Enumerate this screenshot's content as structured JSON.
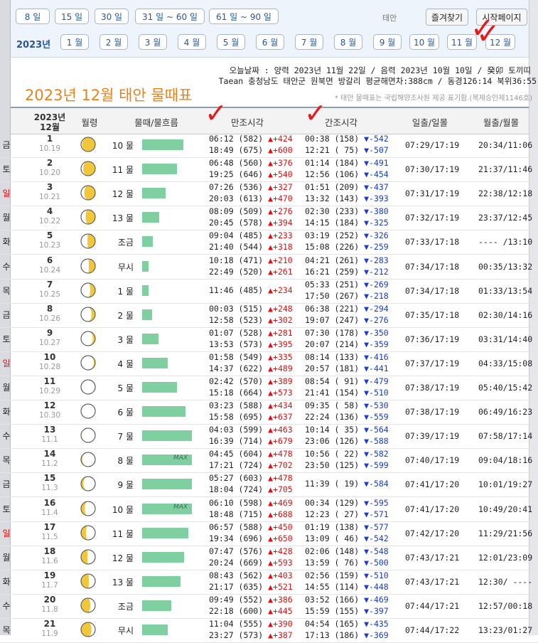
{
  "range_buttons": [
    "8 일",
    "15 일",
    "30 일",
    "31 일 ~ 60 일",
    "61 일 ~ 90 일"
  ],
  "taean_label": "태안",
  "favorites_label": "즐겨찾기",
  "homepage_label": "시작페이지",
  "year_label": "2023년",
  "months": [
    "1 월",
    "2 월",
    "3 월",
    "4 월",
    "5 월",
    "6 월",
    "7 월",
    "8 월",
    "9 월",
    "10 월",
    "11 월",
    "12 월"
  ],
  "info_line1": "오늘날짜 : 양력 2023년 11월 22일 / 음력 2023년 10월 10일 / 癸卯 토끼띠",
  "info_line2": "Taean 충청남도 태안군 원북면 방갈리 평균해면차:388cm / 동경126:14 북위36:55",
  "page_title": "2023년 12월 태안 물때표",
  "notice": "* 태안 물때표는 국립해양조사원 제공 표기함.(복제승인제1146호)",
  "header": {
    "date_top": "2023년",
    "date_bottom": "12월",
    "moon": "월령",
    "tide": "물때/물흐름",
    "high": "만조시각",
    "low": "간조시각",
    "sunrise": "일출/일몰",
    "moonrise": "월출/월몰"
  },
  "colors": {
    "bar": "#7fcfa0",
    "up": "#e01010",
    "down": "#1a3bd0",
    "title": "#e8821e",
    "check": "#e21b1b"
  },
  "rows": [
    {
      "dow": "금",
      "day": "1",
      "lunar": "10.19",
      "moon": 0.92,
      "tide": "10 물",
      "flow": 0.45,
      "max": "",
      "h1": "06:12 (582)",
      "h1d": "▲+424",
      "h2": "18:49 (675)",
      "h2d": "▲+600",
      "l1": "00:38 (158)",
      "l1d": "▼-542",
      "l2": "12:21 ( 75)",
      "l2d": "▼-507",
      "sun": "07:29/17:19",
      "moonrise": "20:34/11:06"
    },
    {
      "dow": "토",
      "day": "2",
      "lunar": "10.20",
      "moon": 0.85,
      "tide": "11 물",
      "flow": 0.38,
      "max": "",
      "h1": "06:48 (560)",
      "h1d": "▲+376",
      "h2": "19:25 (646)",
      "h2d": "▲+540",
      "l1": "01:14 (184)",
      "l1d": "▼-491",
      "l2": "12:56 (106)",
      "l2d": "▼-454",
      "sun": "07:30/17:19",
      "moonrise": "21:37/11:46"
    },
    {
      "dow": "일",
      "day": "3",
      "lunar": "10.21",
      "moon": 0.77,
      "tide": "12 물",
      "flow": 0.26,
      "max": "",
      "h1": "07:26 (536)",
      "h1d": "▲+327",
      "h2": "20:03 (613)",
      "h2d": "▲+470",
      "l1": "01:51 (209)",
      "l1d": "▼-437",
      "l2": "13:32 (143)",
      "l2d": "▼-393",
      "sun": "07:31/17:19",
      "moonrise": "22:38/12:18"
    },
    {
      "dow": "월",
      "day": "4",
      "lunar": "10.22",
      "moon": 0.68,
      "tide": "13 물",
      "flow": 0.19,
      "max": "",
      "h1": "08:09 (509)",
      "h1d": "▲+276",
      "h2": "20:45 (578)",
      "h2d": "▲+394",
      "l1": "02:30 (233)",
      "l1d": "▼-380",
      "l2": "14:15 (184)",
      "l2d": "▼-325",
      "sun": "07:32/17:19",
      "moonrise": "23:37/12:45"
    },
    {
      "dow": "화",
      "day": "5",
      "lunar": "10.23",
      "moon": 0.55,
      "tide": "조금",
      "flow": 0.12,
      "max": "",
      "h1": "09:04 (485)",
      "h1d": "▲+233",
      "h2": "21:40 (544)",
      "h2d": "▲+318",
      "l1": "03:19 (252)",
      "l1d": "▼-326",
      "l2": "15:08 (226)",
      "l2d": "▼-259",
      "sun": "07:33/17:18",
      "moonrise": "---- /13:10"
    },
    {
      "dow": "수",
      "day": "6",
      "lunar": "10.24",
      "moon": 0.45,
      "tide": "무시",
      "flow": 0.07,
      "max": "",
      "h1": "10:18 (471)",
      "h1d": "▲+210",
      "h2": "22:49 (520)",
      "h2d": "▲+261",
      "l1": "04:21 (261)",
      "l1d": "▼-283",
      "l2": "16:21 (259)",
      "l2d": "▼-212",
      "sun": "07:34/17:18",
      "moonrise": "00:35/13:32"
    },
    {
      "dow": "목",
      "day": "7",
      "lunar": "10.25",
      "moon": 0.35,
      "tide": "1 물",
      "flow": 0.07,
      "max": "",
      "h1": "11:46 (485)",
      "h1d": "▲+234",
      "h2": "",
      "h2d": "",
      "l1": "05:33 (251)",
      "l1d": "▼-269",
      "l2": "17:50 (267)",
      "l2d": "▼-218",
      "sun": "07:34/17:18",
      "moonrise": "01:33/13:54"
    },
    {
      "dow": "금",
      "day": "8",
      "lunar": "10.26",
      "moon": 0.26,
      "tide": "2 물",
      "flow": 0.11,
      "max": "",
      "h1": "00:03 (515)",
      "h1d": "▲+248",
      "h2": "12:58 (523)",
      "h2d": "▲+302",
      "l1": "06:38 (221)",
      "l1d": "▼-294",
      "l2": "19:07 (247)",
      "l2d": "▼-276",
      "sun": "07:35/17:18",
      "moonrise": "02:30/14:16"
    },
    {
      "dow": "토",
      "day": "9",
      "lunar": "10.27",
      "moon": 0.17,
      "tide": "3 물",
      "flow": 0.18,
      "max": "",
      "h1": "01:07 (528)",
      "h1d": "▲+281",
      "h2": "13:53 (573)",
      "h2d": "▲+395",
      "l1": "07:30 (178)",
      "l1d": "▼-350",
      "l2": "20:07 (214)",
      "l2d": "▼-359",
      "sun": "07:36/17:19",
      "moonrise": "03:31/14:40"
    },
    {
      "dow": "일",
      "day": "10",
      "lunar": "10.28",
      "moon": 0.1,
      "tide": "4 물",
      "flow": 0.28,
      "max": "",
      "h1": "01:58 (549)",
      "h1d": "▲+335",
      "h2": "14:37 (622)",
      "h2d": "▲+489",
      "l1": "08:14 (133)",
      "l1d": "▼-416",
      "l2": "20:57 (181)",
      "l2d": "▼-441",
      "sun": "07:37/17:19",
      "moonrise": "04:33/15:08"
    },
    {
      "dow": "월",
      "day": "11",
      "lunar": "10.29",
      "moon": 0.04,
      "tide": "5 물",
      "flow": 0.38,
      "max": "",
      "h1": "02:42 (570)",
      "h1d": "▲+389",
      "h2": "15:18 (664)",
      "h2d": "▲+573",
      "l1": "08:54 ( 91)",
      "l1d": "▼-479",
      "l2": "21:41 (154)",
      "l2d": "▼-510",
      "sun": "07:38/17:19",
      "moonrise": "05:40/15:42"
    },
    {
      "dow": "화",
      "day": "12",
      "lunar": "10.30",
      "moon": 0.0,
      "tide": "6 물",
      "flow": 0.48,
      "max": "",
      "h1": "03:23 (588)",
      "h1d": "▲+434",
      "h2": "15:58 (695)",
      "h2d": "▲+637",
      "l1": "09:35 ( 58)",
      "l1d": "▼-530",
      "l2": "22:24 (136)",
      "l2d": "▼-559",
      "sun": "07:38/17:19",
      "moonrise": "06:49/16:23"
    },
    {
      "dow": "수",
      "day": "13",
      "lunar": "11.1",
      "moon": -0.03,
      "tide": "7 물",
      "flow": 0.55,
      "max": "",
      "h1": "04:03 (599)",
      "h1d": "▲+463",
      "h2": "16:39 (714)",
      "h2d": "▲+679",
      "l1": "10:14 ( 35)",
      "l1d": "▼-564",
      "l2": "23:06 (126)",
      "l2d": "▼-588",
      "sun": "07:39/17:19",
      "moonrise": "07:58/17:14"
    },
    {
      "dow": "목",
      "day": "14",
      "lunar": "11.2",
      "moon": -0.09,
      "tide": "8 물",
      "flow": 0.55,
      "max": "MAX",
      "h1": "04:45 (604)",
      "h1d": "▲+478",
      "h2": "17:21 (724)",
      "h2d": "▲+702",
      "l1": "10:56 ( 22)",
      "l1d": "▼-582",
      "l2": "23:50 (125)",
      "l2d": "▼-599",
      "sun": "07:40/17:19",
      "moonrise": "09:04/18:16"
    },
    {
      "dow": "금",
      "day": "15",
      "lunar": "11.3",
      "moon": -0.17,
      "tide": "9 물",
      "flow": 0.55,
      "max": "",
      "h1": "05:27 (603)",
      "h1d": "▲+478",
      "h2": "18:04 (724)",
      "h2d": "▲+705",
      "l1": "11:39 ( 19)",
      "l1d": "▼-584",
      "l2": "",
      "l2d": "",
      "sun": "07:41/17:20",
      "moonrise": "10:01/19:27"
    },
    {
      "dow": "토",
      "day": "16",
      "lunar": "11.4",
      "moon": -0.26,
      "tide": "10 물",
      "flow": 0.55,
      "max": "MAX",
      "h1": "06:10 (598)",
      "h1d": "▲+469",
      "h2": "18:48 (715)",
      "h2d": "▲+688",
      "l1": "00:34 (129)",
      "l1d": "▼-595",
      "l2": "12:23 ( 27)",
      "l2d": "▼-571",
      "sun": "07:41/17:20",
      "moonrise": "10:49/20:41"
    },
    {
      "dow": "일",
      "day": "17",
      "lunar": "11.5",
      "moon": -0.35,
      "tide": "11 물",
      "flow": 0.51,
      "max": "",
      "h1": "06:57 (588)",
      "h1d": "▲+450",
      "h2": "19:34 (696)",
      "h2d": "▲+650",
      "l1": "01:19 (138)",
      "l1d": "▼-577",
      "l2": "13:09 ( 46)",
      "l2d": "▼-542",
      "sun": "07:42/17:20",
      "moonrise": "11:29/21:56"
    },
    {
      "dow": "월",
      "day": "18",
      "lunar": "11.6",
      "moon": -0.45,
      "tide": "12 물",
      "flow": 0.46,
      "max": "",
      "h1": "07:47 (576)",
      "h1d": "▲+428",
      "h2": "20:24 (669)",
      "h2d": "▲+593",
      "l1": "02:06 (148)",
      "l1d": "▼-548",
      "l2": "13:59 ( 76)",
      "l2d": "▼-500",
      "sun": "07:43/17:21",
      "moonrise": "12:01/23:09"
    },
    {
      "dow": "화",
      "day": "19",
      "lunar": "11.7",
      "moon": -0.55,
      "tide": "13 물",
      "flow": 0.42,
      "max": "",
      "h1": "08:43 (562)",
      "h1d": "▲+403",
      "h2": "21:17 (635)",
      "h2d": "▲+521",
      "l1": "02:56 (159)",
      "l1d": "▼-510",
      "l2": "14:55 (114)",
      "l2d": "▼-448",
      "sun": "07:43/17:21",
      "moonrise": "12:30/ ----"
    },
    {
      "dow": "수",
      "day": "20",
      "lunar": "11.8",
      "moon": -0.65,
      "tide": "조금",
      "flow": 0.32,
      "max": "",
      "h1": "09:49 (552)",
      "h1d": "▲+386",
      "h2": "22:18 (600)",
      "h2d": "▲+445",
      "l1": "03:52 (166)",
      "l1d": "▼-469",
      "l2": "15:59 (155)",
      "l2d": "▼-397",
      "sun": "07:44/17:21",
      "moonrise": "12:57/00:18"
    },
    {
      "dow": "목",
      "day": "21",
      "lunar": "11.9",
      "moon": -0.74,
      "tide": "무시",
      "flow": 0.28,
      "max": "",
      "h1": "11:04 (555)",
      "h1d": "▲+390",
      "h2": "23:27 (573)",
      "h2d": "▲+387",
      "l1": "04:54 (165)",
      "l1d": "▼-435",
      "l2": "17:13 (186)",
      "l2d": "▼-369",
      "sun": "07:44/17:22",
      "moonrise": "13:23/01:27"
    }
  ]
}
